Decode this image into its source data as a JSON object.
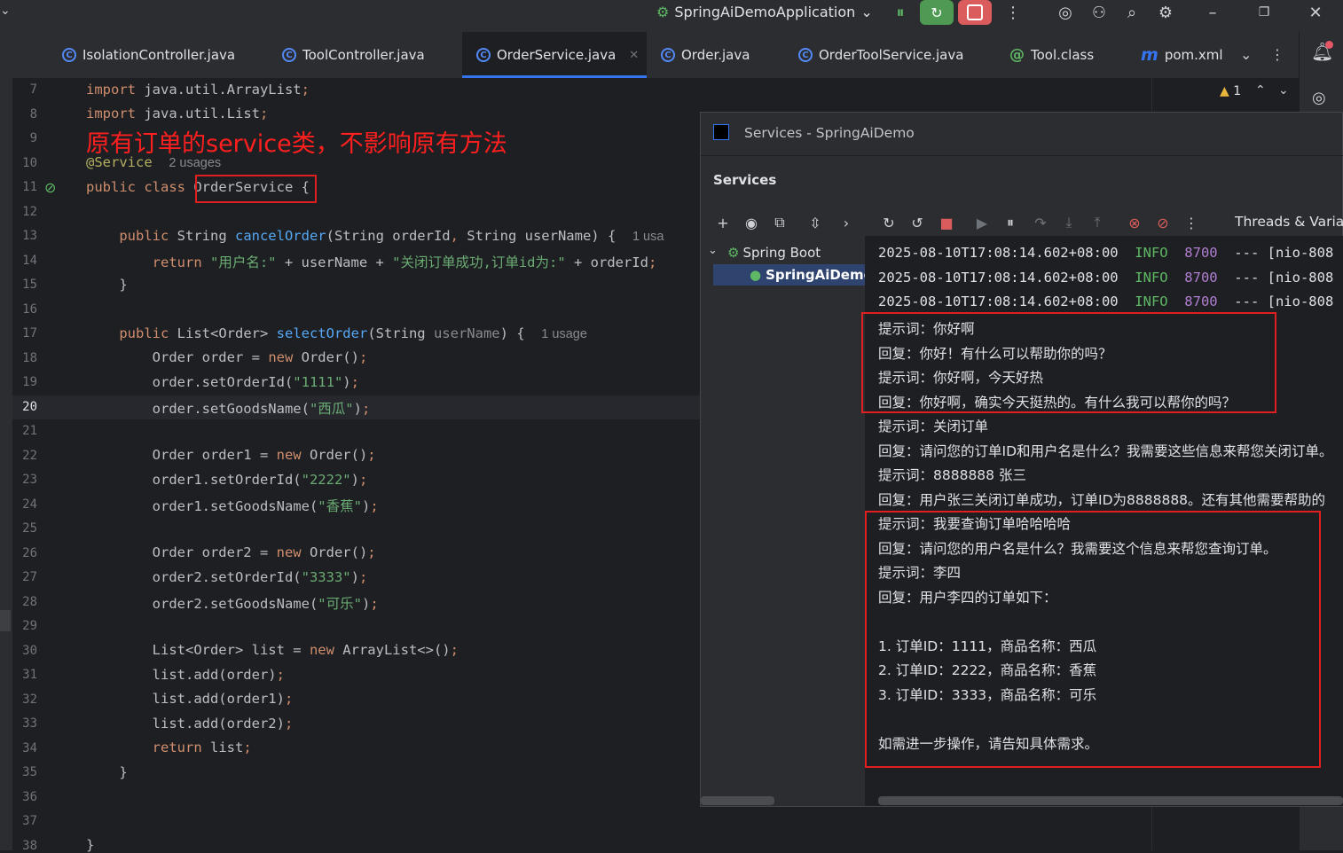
{
  "titlebar": {
    "run_config": "SpringAiDemoApplication",
    "colors": {
      "run_green": "#5fb865",
      "stop_red": "#db5c5c"
    }
  },
  "tabs": [
    {
      "label": "IsolationController.java",
      "icon": "class-icon"
    },
    {
      "label": "ToolController.java",
      "icon": "class-icon"
    },
    {
      "label": "OrderService.java",
      "icon": "class-icon",
      "active": true
    },
    {
      "label": "Order.java",
      "icon": "class-icon"
    },
    {
      "label": "OrderToolService.java",
      "icon": "class-icon"
    },
    {
      "label": "Tool.class",
      "icon": "annotation-icon"
    },
    {
      "label": "pom.xml",
      "icon": "maven-icon"
    }
  ],
  "editor": {
    "line_numbers": [
      "7",
      "8",
      "9",
      "10",
      "11",
      "12",
      "13",
      "14",
      "15",
      "16",
      "17",
      "18",
      "19",
      "20",
      "21",
      "22",
      "23",
      "24",
      "25",
      "26",
      "27",
      "28",
      "29",
      "30",
      "31",
      "32",
      "33",
      "34",
      "35",
      "36",
      "37",
      "38"
    ],
    "annotation_text": "原有订单的service类，不影响原有方法",
    "usages_2": "2 usages",
    "usages_1": "1 usage",
    "usages_cut": "1 usa",
    "class_name": "OrderService",
    "warning_count": "1"
  },
  "services": {
    "window_title": "Services - SpringAiDemo",
    "header": "Services",
    "threads_label": "Threads & Variab",
    "tree": {
      "group": "Spring Boot",
      "app": "SpringAiDemo"
    },
    "log_lines": [
      {
        "time": "2025-08-10T17:08:14.602+08:00",
        "level": "INFO",
        "pid": "8700",
        "rest": "--- [nio-808"
      },
      {
        "time": "2025-08-10T17:08:14.602+08:00",
        "level": "INFO",
        "pid": "8700",
        "rest": "--- [nio-808"
      },
      {
        "time": "2025-08-10T17:08:14.602+08:00",
        "level": "INFO",
        "pid": "8700",
        "rest": "--- [nio-808"
      }
    ],
    "chat_lines": [
      "提示词：你好啊",
      "回复：你好！有什么可以帮助你的吗？",
      "提示词：你好啊，今天好热",
      "回复：你好啊，确实今天挺热的。有什么我可以帮你的吗？",
      "提示词：关闭订单",
      "回复：请问您的订单ID和用户名是什么？我需要这些信息来帮您关闭订单。",
      "提示词：8888888 张三",
      "回复：用户张三关闭订单成功，订单ID为8888888。还有其他需要帮助的",
      "提示词：我要查询订单哈哈哈哈",
      "回复：请问您的用户名是什么？我需要这个信息来帮您查询订单。",
      "提示词：李四",
      "回复：用户李四的订单如下：",
      "",
      "1. 订单ID：1111，商品名称：西瓜",
      "2. 订单ID：2222，商品名称：香蕉",
      "3. 订单ID：3333，商品名称：可乐",
      "",
      "如需进一步操作，请告知具体需求。"
    ]
  }
}
